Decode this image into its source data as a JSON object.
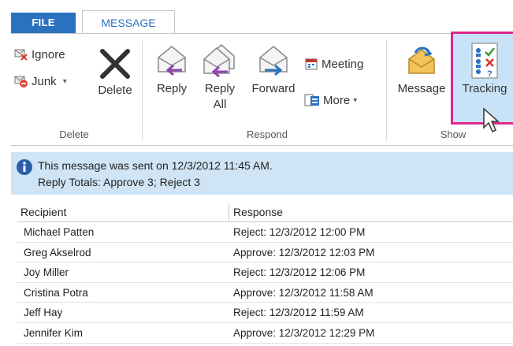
{
  "tabs": {
    "file": "FILE",
    "message": "MESSAGE"
  },
  "ribbon": {
    "delete_group": {
      "label": "Delete",
      "ignore": "Ignore",
      "junk": "Junk",
      "delete": "Delete"
    },
    "respond_group": {
      "label": "Respond",
      "reply": "Reply",
      "reply_all_line1": "Reply",
      "reply_all_line2": "All",
      "forward": "Forward",
      "meeting": "Meeting",
      "more": "More"
    },
    "show_group": {
      "label": "Show",
      "message": "Message",
      "tracking": "Tracking"
    }
  },
  "info": {
    "line1": "This message was sent on 12/3/2012 11:45 AM.",
    "line2": "Reply Totals: Approve 3; Reject 3"
  },
  "table": {
    "headers": {
      "recipient": "Recipient",
      "response": "Response"
    },
    "rows": [
      {
        "recipient": "Michael Patten",
        "response": "Reject: 12/3/2012 12:00 PM"
      },
      {
        "recipient": "Greg Akselrod",
        "response": "Approve: 12/3/2012 12:03 PM"
      },
      {
        "recipient": "Joy Miller",
        "response": "Reject: 12/3/2012 12:06 PM"
      },
      {
        "recipient": "Cristina Potra",
        "response": "Approve: 12/3/2012 11:58 AM"
      },
      {
        "recipient": "Jeff Hay",
        "response": "Reject: 12/3/2012 11:59 AM"
      },
      {
        "recipient": "Jennifer Kim",
        "response": "Approve: 12/3/2012 12:29 PM"
      }
    ]
  },
  "colors": {
    "file_tab": "#2a72c0",
    "highlight_border": "#e0288c",
    "highlight_fill": "#c8e3f7",
    "infobar": "#cfe4f4"
  }
}
